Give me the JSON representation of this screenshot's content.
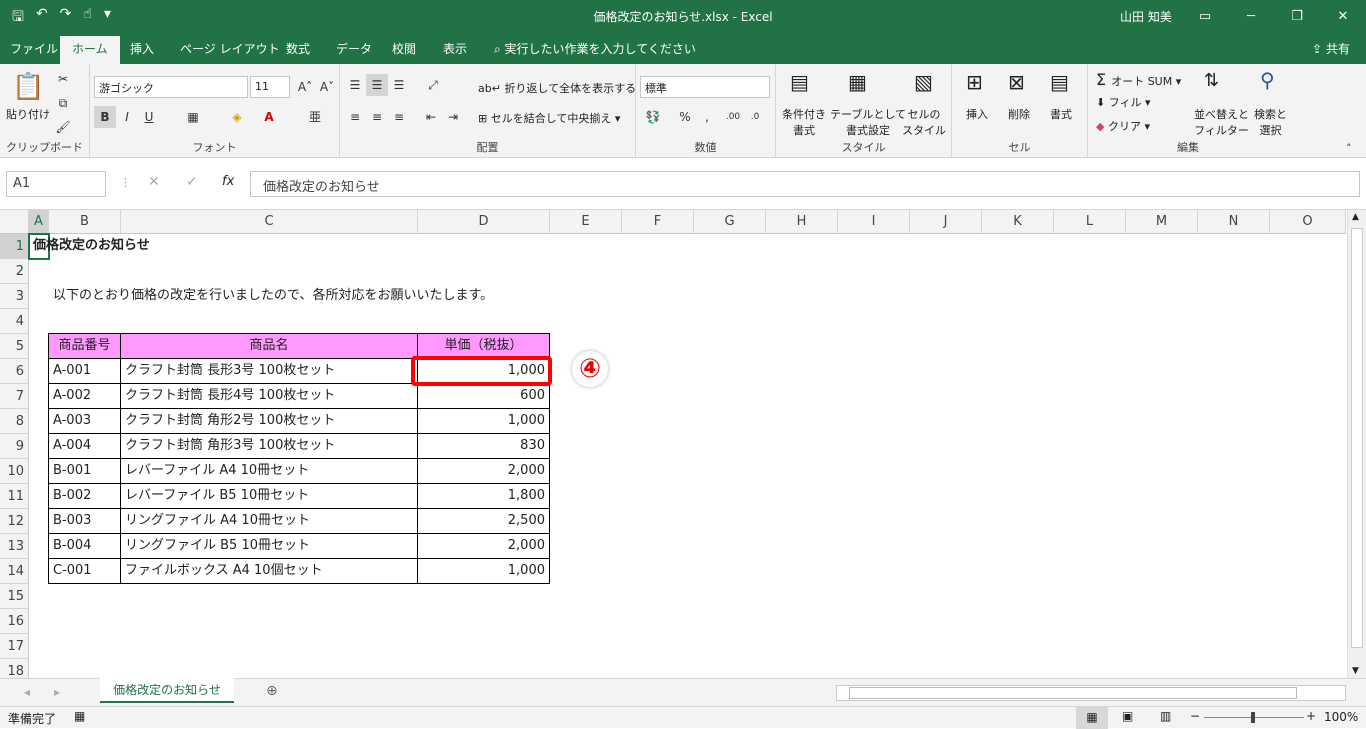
{
  "title": "価格改定のお知らせ.xlsx  -  Excel",
  "user": "山田 知美",
  "tabs": [
    "ファイル",
    "ホーム",
    "挿入",
    "ページ レイアウト",
    "数式",
    "データ",
    "校閲",
    "表示"
  ],
  "tell_me": "実行したい作業を入力してください",
  "share": "共有",
  "ribbon": {
    "clipboard": {
      "label": "クリップボード",
      "paste": "貼り付け"
    },
    "font": {
      "label": "フォント",
      "name": "游ゴシック",
      "size": "11",
      "bold": "B",
      "italic": "I",
      "underline": "U"
    },
    "alignment": {
      "label": "配置",
      "wrap": "折り返して全体を表示する",
      "merge": "セルを結合して中央揃え"
    },
    "number": {
      "label": "数値",
      "format": "標準",
      "percent": "%"
    },
    "styles": {
      "label": "スタイル",
      "cond1": "条件付き",
      "cond2": "書式",
      "table1": "テーブルとして",
      "table2": "書式設定",
      "cell1": "セルの",
      "cell2": "スタイル"
    },
    "cells": {
      "label": "セル",
      "insert": "挿入",
      "delete": "削除",
      "format": "書式"
    },
    "editing": {
      "label": "編集",
      "autosum": "オート SUM",
      "fill": "フィル",
      "clear": "クリア",
      "sort1": "並べ替えと",
      "sort2": "フィルター",
      "find1": "検索と",
      "find2": "選択"
    }
  },
  "namebox": "A1",
  "formula": "価格改定のお知らせ",
  "columns": [
    "A",
    "B",
    "C",
    "D",
    "E",
    "F",
    "G",
    "H",
    "I",
    "J",
    "K",
    "L",
    "M",
    "N",
    "O"
  ],
  "rows": [
    "1",
    "2",
    "3",
    "4",
    "5",
    "6",
    "7",
    "8",
    "9",
    "10",
    "11",
    "12",
    "13",
    "14",
    "15",
    "16",
    "17",
    "18"
  ],
  "sheet": {
    "title": "価格改定のお知らせ",
    "intro": "以下のとおり価格の改定を行いましたので、各所対応をお願いいたします。",
    "headers": [
      "商品番号",
      "商品名",
      "単価（税抜）"
    ],
    "data": [
      [
        "A-001",
        "クラフト封筒 長形3号 100枚セット",
        "1,000"
      ],
      [
        "A-002",
        "クラフト封筒 長形4号 100枚セット",
        "600"
      ],
      [
        "A-003",
        "クラフト封筒 角形2号 100枚セット",
        "1,000"
      ],
      [
        "A-004",
        "クラフト封筒 角形3号 100枚セット",
        "830"
      ],
      [
        "B-001",
        "レバーファイル A4 10冊セット",
        "2,000"
      ],
      [
        "B-002",
        "レバーファイル B5 10冊セット",
        "1,800"
      ],
      [
        "B-003",
        "リングファイル A4 10冊セット",
        "2,500"
      ],
      [
        "B-004",
        "リングファイル B5 10冊セット",
        "2,000"
      ],
      [
        "C-001",
        "ファイルボックス A4 10個セット",
        "1,000"
      ]
    ]
  },
  "sheet_tab": "価格改定のお知らせ",
  "status": {
    "ready": "準備完了",
    "zoom": "100%"
  },
  "annotation": "④"
}
